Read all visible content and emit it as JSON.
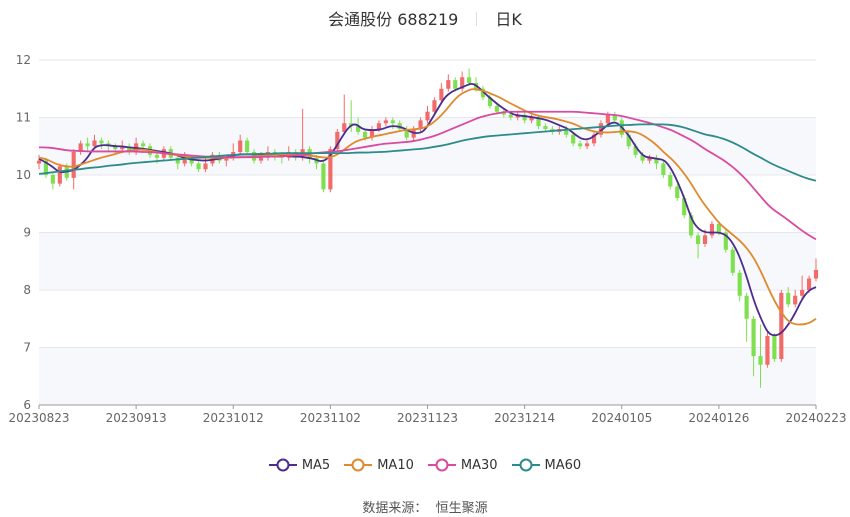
{
  "header": {
    "stock": "会通股份 688219",
    "period": "日K"
  },
  "source": {
    "label": "数据来源：",
    "provider": "恒生聚源"
  },
  "chart_data": {
    "type": "candlestick",
    "title": "会通股份 688219",
    "period": "日K",
    "x_tick_labels": [
      "20230823",
      "20230913",
      "20231012",
      "20231102",
      "20231123",
      "20231214",
      "20240105",
      "20240126",
      "20240223"
    ],
    "y_ticks": [
      6,
      7,
      8,
      9,
      10,
      11,
      12
    ],
    "ylim": [
      6,
      12
    ],
    "grid": "horizontal",
    "legend_position": "bottom-center",
    "up_color": "#f26b6b",
    "down_color": "#7ee04f",
    "candles": [
      [
        10.2,
        10.25,
        10.35,
        10.1
      ],
      [
        10.25,
        10.0,
        10.3,
        9.95
      ],
      [
        10.0,
        9.85,
        10.05,
        9.75
      ],
      [
        9.85,
        10.15,
        10.2,
        9.8
      ],
      [
        10.15,
        9.95,
        10.2,
        9.9
      ],
      [
        9.95,
        10.4,
        10.45,
        9.75
      ],
      [
        10.4,
        10.55,
        10.6,
        10.35
      ],
      [
        10.55,
        10.5,
        10.65,
        10.4
      ],
      [
        10.5,
        10.6,
        10.7,
        10.45
      ],
      [
        10.6,
        10.55,
        10.65,
        10.45
      ],
      [
        10.55,
        10.5,
        10.6,
        10.4
      ],
      [
        10.5,
        10.45,
        10.55,
        10.35
      ],
      [
        10.45,
        10.5,
        10.6,
        10.4
      ],
      [
        10.5,
        10.4,
        10.55,
        10.35
      ],
      [
        10.4,
        10.55,
        10.65,
        10.35
      ],
      [
        10.55,
        10.5,
        10.6,
        10.4
      ],
      [
        10.5,
        10.35,
        10.55,
        10.3
      ],
      [
        10.35,
        10.3,
        10.4,
        10.2
      ],
      [
        10.3,
        10.45,
        10.5,
        10.25
      ],
      [
        10.45,
        10.3,
        10.5,
        10.25
      ],
      [
        10.3,
        10.2,
        10.35,
        10.1
      ],
      [
        10.2,
        10.3,
        10.4,
        10.15
      ],
      [
        10.3,
        10.2,
        10.35,
        10.15
      ],
      [
        10.2,
        10.1,
        10.25,
        10.05
      ],
      [
        10.1,
        10.2,
        10.3,
        10.05
      ],
      [
        10.2,
        10.35,
        10.4,
        10.15
      ],
      [
        10.35,
        10.25,
        10.4,
        10.2
      ],
      [
        10.25,
        10.3,
        10.35,
        10.15
      ],
      [
        10.3,
        10.4,
        10.55,
        10.25
      ],
      [
        10.4,
        10.6,
        10.7,
        10.35
      ],
      [
        10.6,
        10.4,
        10.65,
        10.35
      ],
      [
        10.4,
        10.25,
        10.45,
        10.2
      ],
      [
        10.25,
        10.3,
        10.4,
        10.2
      ],
      [
        10.3,
        10.4,
        10.5,
        10.25
      ],
      [
        10.4,
        10.35,
        10.45,
        10.25
      ],
      [
        10.35,
        10.3,
        10.4,
        10.2
      ],
      [
        10.3,
        10.4,
        10.5,
        10.25
      ],
      [
        10.4,
        10.3,
        10.45,
        10.25
      ],
      [
        10.3,
        10.45,
        11.15,
        10.25
      ],
      [
        10.45,
        10.3,
        10.5,
        10.2
      ],
      [
        10.3,
        10.2,
        10.35,
        10.1
      ],
      [
        10.2,
        9.75,
        10.25,
        9.7
      ],
      [
        9.75,
        10.45,
        10.5,
        9.7
      ],
      [
        10.45,
        10.75,
        10.8,
        10.4
      ],
      [
        10.75,
        10.9,
        11.4,
        10.7
      ],
      [
        10.9,
        10.85,
        11.3,
        10.75
      ],
      [
        10.85,
        10.75,
        11.0,
        10.7
      ],
      [
        10.75,
        10.65,
        10.8,
        10.6
      ],
      [
        10.65,
        10.8,
        10.85,
        10.6
      ],
      [
        10.8,
        10.9,
        10.95,
        10.75
      ],
      [
        10.9,
        10.95,
        11.0,
        10.85
      ],
      [
        10.95,
        10.9,
        11.0,
        10.8
      ],
      [
        10.9,
        10.8,
        10.95,
        10.75
      ],
      [
        10.8,
        10.65,
        10.85,
        10.6
      ],
      [
        10.65,
        10.8,
        10.85,
        10.6
      ],
      [
        10.8,
        10.95,
        11.0,
        10.75
      ],
      [
        10.95,
        11.1,
        11.2,
        10.9
      ],
      [
        11.1,
        11.3,
        11.35,
        11.05
      ],
      [
        11.3,
        11.5,
        11.6,
        11.25
      ],
      [
        11.5,
        11.65,
        11.75,
        11.45
      ],
      [
        11.65,
        11.5,
        11.7,
        11.45
      ],
      [
        11.5,
        11.7,
        11.8,
        11.45
      ],
      [
        11.7,
        11.6,
        11.85,
        11.55
      ],
      [
        11.6,
        11.5,
        11.7,
        11.45
      ],
      [
        11.5,
        11.35,
        11.55,
        11.3
      ],
      [
        11.35,
        11.2,
        11.4,
        11.15
      ],
      [
        11.2,
        11.1,
        11.25,
        11.05
      ],
      [
        11.1,
        11.05,
        11.15,
        11.0
      ],
      [
        11.05,
        11.0,
        11.1,
        10.95
      ],
      [
        11.0,
        11.05,
        11.1,
        10.95
      ],
      [
        11.05,
        10.95,
        11.1,
        10.9
      ],
      [
        10.95,
        11.0,
        11.05,
        10.9
      ],
      [
        11.0,
        10.85,
        11.05,
        10.8
      ],
      [
        10.85,
        10.8,
        10.9,
        10.75
      ],
      [
        10.8,
        10.75,
        10.85,
        10.7
      ],
      [
        10.75,
        10.8,
        10.85,
        10.7
      ],
      [
        10.8,
        10.7,
        10.85,
        10.65
      ],
      [
        10.7,
        10.55,
        10.75,
        10.5
      ],
      [
        10.55,
        10.5,
        10.6,
        10.45
      ],
      [
        10.5,
        10.55,
        10.6,
        10.45
      ],
      [
        10.55,
        10.7,
        10.75,
        10.5
      ],
      [
        10.7,
        10.9,
        10.95,
        10.65
      ],
      [
        10.9,
        11.05,
        11.1,
        10.85
      ],
      [
        11.05,
        10.95,
        11.1,
        10.9
      ],
      [
        10.95,
        10.7,
        11.0,
        10.65
      ],
      [
        10.7,
        10.5,
        10.75,
        10.45
      ],
      [
        10.5,
        10.35,
        10.55,
        10.3
      ],
      [
        10.35,
        10.25,
        10.4,
        10.2
      ],
      [
        10.25,
        10.3,
        10.35,
        10.2
      ],
      [
        10.3,
        10.2,
        10.35,
        10.1
      ],
      [
        10.2,
        10.0,
        10.25,
        9.95
      ],
      [
        10.0,
        9.8,
        10.05,
        9.75
      ],
      [
        9.8,
        9.6,
        9.85,
        9.55
      ],
      [
        9.6,
        9.3,
        9.65,
        9.25
      ],
      [
        9.3,
        8.95,
        9.35,
        8.9
      ],
      [
        8.95,
        8.8,
        9.0,
        8.55
      ],
      [
        8.8,
        8.95,
        9.05,
        8.75
      ],
      [
        8.95,
        9.15,
        9.2,
        8.9
      ],
      [
        9.15,
        9.0,
        9.2,
        8.95
      ],
      [
        9.0,
        8.7,
        9.05,
        8.65
      ],
      [
        8.7,
        8.3,
        8.75,
        8.25
      ],
      [
        8.3,
        7.9,
        8.35,
        7.8
      ],
      [
        7.9,
        7.5,
        7.95,
        7.1
      ],
      [
        7.5,
        6.85,
        7.55,
        6.5
      ],
      [
        6.85,
        6.7,
        7.4,
        6.3
      ],
      [
        6.7,
        7.2,
        7.3,
        6.65
      ],
      [
        7.2,
        6.8,
        7.25,
        6.75
      ],
      [
        6.8,
        7.95,
        8.0,
        6.75
      ],
      [
        7.95,
        7.75,
        8.05,
        7.7
      ],
      [
        7.75,
        7.9,
        8.0,
        7.7
      ],
      [
        7.9,
        8.0,
        8.25,
        7.85
      ],
      [
        8.0,
        8.2,
        8.25,
        7.95
      ],
      [
        8.2,
        8.35,
        8.55,
        8.15
      ]
    ],
    "series": [
      {
        "name": "MA5",
        "color": "#4b2d8e",
        "values": [
          10.28,
          10.22,
          10.14,
          10.04,
          10.06,
          10.08,
          10.17,
          10.29,
          10.48,
          10.52,
          10.52,
          10.5,
          10.5,
          10.48,
          10.47,
          10.46,
          10.44,
          10.42,
          10.4,
          10.38,
          10.35,
          10.3,
          10.27,
          10.26,
          10.25,
          10.26,
          10.28,
          10.3,
          10.33,
          10.36,
          10.36,
          10.36,
          10.36,
          10.36,
          10.36,
          10.35,
          10.33,
          10.32,
          10.32,
          10.3,
          10.28,
          10.23,
          10.28,
          10.45,
          10.65,
          10.83,
          10.9,
          10.8,
          10.78,
          10.78,
          10.8,
          10.85,
          10.85,
          10.82,
          10.75,
          10.72,
          10.76,
          10.95,
          11.15,
          11.35,
          11.45,
          11.5,
          11.55,
          11.6,
          11.52,
          11.4,
          11.3,
          11.2,
          11.12,
          11.05,
          11.03,
          11.02,
          11.0,
          10.98,
          10.95,
          10.9,
          10.85,
          10.8,
          10.7,
          10.62,
          10.62,
          10.7,
          10.8,
          10.9,
          10.92,
          10.8,
          10.65,
          10.45,
          10.32,
          10.3,
          10.28,
          10.26,
          10.1,
          9.85,
          9.55,
          9.2,
          9.05,
          9.0,
          9.0,
          9.0,
          8.95,
          8.8,
          8.55,
          8.2,
          7.8,
          7.5,
          7.25,
          7.2,
          7.25,
          7.4,
          7.6,
          7.85,
          8.0,
          8.05
        ]
      },
      {
        "name": "MA10",
        "color": "#e08a2e",
        "values": [
          10.3,
          10.28,
          10.22,
          10.17,
          10.15,
          10.14,
          10.18,
          10.22,
          10.26,
          10.3,
          10.33,
          10.36,
          10.4,
          10.42,
          10.44,
          10.44,
          10.43,
          10.4,
          10.38,
          10.36,
          10.35,
          10.33,
          10.31,
          10.3,
          10.3,
          10.3,
          10.3,
          10.3,
          10.3,
          10.31,
          10.31,
          10.32,
          10.33,
          10.34,
          10.35,
          10.36,
          10.36,
          10.36,
          10.35,
          10.34,
          10.33,
          10.31,
          10.3,
          10.33,
          10.4,
          10.5,
          10.58,
          10.62,
          10.65,
          10.68,
          10.7,
          10.73,
          10.75,
          10.78,
          10.79,
          10.8,
          10.82,
          10.88,
          10.98,
          11.1,
          11.25,
          11.38,
          11.45,
          11.5,
          11.48,
          11.45,
          11.4,
          11.35,
          11.28,
          11.22,
          11.16,
          11.1,
          11.05,
          11.02,
          11.0,
          10.98,
          10.95,
          10.92,
          10.88,
          10.82,
          10.78,
          10.75,
          10.74,
          10.74,
          10.75,
          10.76,
          10.76,
          10.74,
          10.68,
          10.6,
          10.5,
          10.38,
          10.28,
          10.15,
          10.0,
          9.82,
          9.62,
          9.45,
          9.3,
          9.15,
          9.05,
          8.95,
          8.85,
          8.72,
          8.55,
          8.32,
          8.05,
          7.8,
          7.6,
          7.45,
          7.4,
          7.4,
          7.42,
          7.5
        ]
      },
      {
        "name": "MA30",
        "color": "#d94aa0",
        "values": [
          10.48,
          10.48,
          10.47,
          10.45,
          10.43,
          10.42,
          10.42,
          10.41,
          10.41,
          10.41,
          10.41,
          10.41,
          10.41,
          10.41,
          10.41,
          10.4,
          10.4,
          10.39,
          10.38,
          10.37,
          10.36,
          10.35,
          10.34,
          10.33,
          10.32,
          10.32,
          10.31,
          10.31,
          10.31,
          10.31,
          10.31,
          10.31,
          10.31,
          10.32,
          10.32,
          10.32,
          10.33,
          10.34,
          10.35,
          10.36,
          10.38,
          10.39,
          10.4,
          10.41,
          10.42,
          10.44,
          10.46,
          10.48,
          10.5,
          10.52,
          10.54,
          10.55,
          10.56,
          10.57,
          10.58,
          10.6,
          10.63,
          10.66,
          10.7,
          10.75,
          10.8,
          10.85,
          10.9,
          10.95,
          11.0,
          11.03,
          11.06,
          11.08,
          11.1,
          11.1,
          11.1,
          11.1,
          11.1,
          11.1,
          11.1,
          11.1,
          11.1,
          11.1,
          11.1,
          11.09,
          11.08,
          11.07,
          11.06,
          11.05,
          11.04,
          11.02,
          10.99,
          10.96,
          10.93,
          10.9,
          10.86,
          10.82,
          10.78,
          10.72,
          10.66,
          10.6,
          10.52,
          10.44,
          10.37,
          10.3,
          10.22,
          10.13,
          10.02,
          9.9,
          9.76,
          9.62,
          9.48,
          9.38,
          9.3,
          9.21,
          9.12,
          9.03,
          8.95,
          8.88
        ]
      },
      {
        "name": "MA60",
        "color": "#2e8b8b",
        "values": [
          10.02,
          10.03,
          10.05,
          10.06,
          10.08,
          10.09,
          10.1,
          10.12,
          10.13,
          10.14,
          10.16,
          10.17,
          10.18,
          10.2,
          10.21,
          10.22,
          10.23,
          10.24,
          10.25,
          10.26,
          10.27,
          10.28,
          10.29,
          10.3,
          10.31,
          10.32,
          10.33,
          10.34,
          10.35,
          10.35,
          10.36,
          10.36,
          10.37,
          10.37,
          10.37,
          10.38,
          10.38,
          10.38,
          10.38,
          10.38,
          10.38,
          10.38,
          10.38,
          10.38,
          10.38,
          10.38,
          10.39,
          10.39,
          10.39,
          10.4,
          10.4,
          10.41,
          10.42,
          10.43,
          10.44,
          10.45,
          10.46,
          10.48,
          10.5,
          10.52,
          10.55,
          10.58,
          10.61,
          10.63,
          10.65,
          10.67,
          10.68,
          10.69,
          10.7,
          10.71,
          10.72,
          10.73,
          10.74,
          10.75,
          10.76,
          10.77,
          10.78,
          10.79,
          10.8,
          10.81,
          10.82,
          10.83,
          10.84,
          10.85,
          10.86,
          10.87,
          10.87,
          10.88,
          10.88,
          10.88,
          10.88,
          10.88,
          10.87,
          10.85,
          10.82,
          10.78,
          10.74,
          10.7,
          10.68,
          10.65,
          10.61,
          10.56,
          10.5,
          10.43,
          10.36,
          10.3,
          10.23,
          10.17,
          10.12,
          10.07,
          10.02,
          9.97,
          9.93,
          9.9
        ]
      }
    ]
  }
}
